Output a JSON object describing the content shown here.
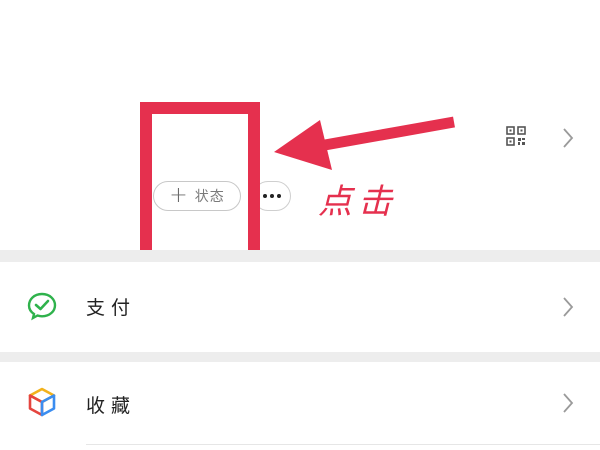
{
  "profile": {
    "status_label": "状态",
    "status_plus": "+",
    "more_icon": "ellipsis-icon",
    "qr_icon": "qr-code-icon"
  },
  "annotation": {
    "text": "点击",
    "color": "#e5304e"
  },
  "menu": {
    "items": [
      {
        "label": "支付",
        "icon": "wechat-pay-icon"
      },
      {
        "label": "收藏",
        "icon": "favorites-cube-icon"
      }
    ]
  }
}
